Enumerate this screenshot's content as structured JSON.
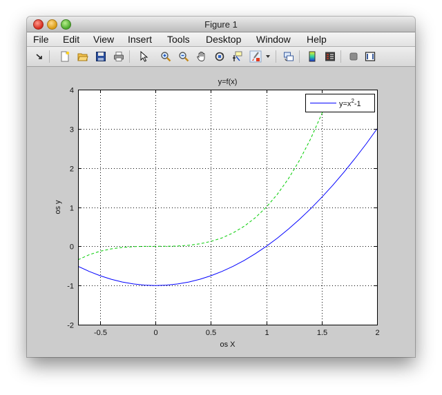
{
  "window": {
    "title": "Figure 1"
  },
  "menubar": {
    "items": [
      "File",
      "Edit",
      "View",
      "Insert",
      "Tools",
      "Desktop",
      "Window",
      "Help"
    ]
  },
  "toolbar": {
    "buttons": [
      "dock-arrow-icon",
      "new-figure-icon",
      "open-folder-icon",
      "save-icon",
      "print-icon",
      "pointer-icon",
      "zoom-in-icon",
      "zoom-out-icon",
      "pan-hand-icon",
      "rotate-3d-icon",
      "data-cursor-icon",
      "brush-icon",
      "brush-dropdown-icon",
      "link-plot-icon",
      "colorbar-icon",
      "legend-icon",
      "hide-tools-icon",
      "show-tools-icon"
    ]
  },
  "chart_data": {
    "type": "line",
    "title": "y=f(x)",
    "xlabel": "os X",
    "ylabel": "os y",
    "xlim": [
      -0.7,
      2
    ],
    "ylim": [
      -2,
      4
    ],
    "xticks": [
      -0.5,
      0,
      0.5,
      1,
      1.5,
      2
    ],
    "xtick_labels": [
      "-0.5",
      "0",
      "0.5",
      "1",
      "1.5",
      "2"
    ],
    "yticks": [
      -2,
      -1,
      0,
      1,
      2,
      3,
      4
    ],
    "ytick_labels": [
      "-2",
      "-1",
      "0",
      "1",
      "2",
      "3",
      "4"
    ],
    "grid": true,
    "legend": {
      "placement": "top-right",
      "entries": [
        {
          "series": 0,
          "label_main": "y=x",
          "label_sup": "2",
          "label_tail": "-1"
        }
      ]
    },
    "series": [
      {
        "name": "y=x^2-1",
        "color": "#0000ff",
        "style": "solid",
        "x": [
          -0.7,
          -0.6,
          -0.5,
          -0.4,
          -0.3,
          -0.2,
          -0.1,
          0,
          0.1,
          0.2,
          0.3,
          0.4,
          0.5,
          0.6,
          0.7,
          0.8,
          0.9,
          1.0,
          1.1,
          1.2,
          1.3,
          1.4,
          1.5,
          1.6,
          1.7,
          1.8,
          1.9,
          2.0
        ],
        "y": [
          -0.51,
          -0.64,
          -0.75,
          -0.84,
          -0.91,
          -0.96,
          -0.99,
          -1.0,
          -0.99,
          -0.96,
          -0.91,
          -0.84,
          -0.75,
          -0.64,
          -0.51,
          -0.36,
          -0.19,
          0.0,
          0.21,
          0.44,
          0.69,
          0.96,
          1.25,
          1.56,
          1.89,
          2.24,
          2.61,
          3.0
        ]
      },
      {
        "color": "#00cc00",
        "style": "dashed",
        "x": [
          -0.7,
          -0.6,
          -0.5,
          -0.4,
          -0.3,
          -0.2,
          -0.1,
          0,
          0.1,
          0.2,
          0.3,
          0.4,
          0.5,
          0.6,
          0.7,
          0.8,
          0.9,
          1.0,
          1.1,
          1.2,
          1.3,
          1.4,
          1.5,
          1.56
        ],
        "y": [
          -0.343,
          -0.216,
          -0.125,
          -0.064,
          -0.027,
          -0.008,
          -0.001,
          0.0,
          0.001,
          0.008,
          0.027,
          0.064,
          0.125,
          0.216,
          0.343,
          0.512,
          0.729,
          1.0,
          1.331,
          1.728,
          2.197,
          2.744,
          3.375,
          3.8
        ]
      }
    ]
  }
}
